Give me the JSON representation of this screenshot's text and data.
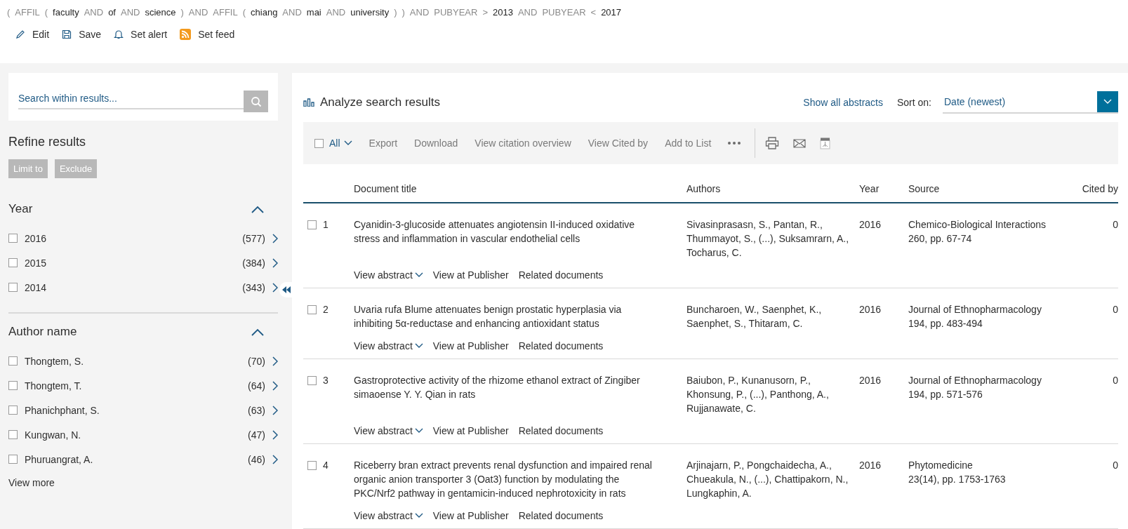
{
  "query": [
    {
      "text": "(",
      "kind": "operator"
    },
    {
      "text": "AFFIL",
      "kind": "operator"
    },
    {
      "text": "(",
      "kind": "operator"
    },
    {
      "text": "faculty",
      "kind": "term"
    },
    {
      "text": "AND",
      "kind": "operator"
    },
    {
      "text": "of",
      "kind": "term"
    },
    {
      "text": "AND",
      "kind": "operator"
    },
    {
      "text": "science",
      "kind": "term"
    },
    {
      "text": ")",
      "kind": "operator"
    },
    {
      "text": "AND",
      "kind": "operator"
    },
    {
      "text": "AFFIL",
      "kind": "operator"
    },
    {
      "text": "(",
      "kind": "operator"
    },
    {
      "text": "chiang",
      "kind": "term"
    },
    {
      "text": "AND",
      "kind": "operator"
    },
    {
      "text": "mai",
      "kind": "term"
    },
    {
      "text": "AND",
      "kind": "operator"
    },
    {
      "text": "university",
      "kind": "term"
    },
    {
      "text": ")",
      "kind": "operator"
    },
    {
      "text": ")",
      "kind": "operator"
    },
    {
      "text": "AND",
      "kind": "operator"
    },
    {
      "text": "PUBYEAR",
      "kind": "operator"
    },
    {
      "text": ">",
      "kind": "operator"
    },
    {
      "text": "2013",
      "kind": "term"
    },
    {
      "text": "AND",
      "kind": "operator"
    },
    {
      "text": "PUBYEAR",
      "kind": "operator"
    },
    {
      "text": "<",
      "kind": "operator"
    },
    {
      "text": "2017",
      "kind": "term"
    }
  ],
  "query_actions": [
    {
      "label": "Edit",
      "kind": "edit"
    },
    {
      "label": "Save",
      "kind": "save"
    },
    {
      "label": "Set alert",
      "kind": "alert"
    },
    {
      "label": "Set feed",
      "kind": "feed"
    }
  ],
  "sidebar": {
    "search": {
      "placeholder": "Search within results..."
    },
    "title": "Refine results",
    "buttons": [
      "Limit to",
      "Exclude"
    ],
    "facets": [
      {
        "title": "Year",
        "expanded": true,
        "items": [
          {
            "label": "2016",
            "count": "(577)",
            "checked": false
          },
          {
            "label": "2015",
            "count": "(384)",
            "checked": false
          },
          {
            "label": "2014",
            "count": "(343)",
            "checked": false
          }
        ]
      },
      {
        "title": "Author name",
        "expanded": true,
        "items": [
          {
            "label": "Thongtem, S.",
            "count": "(70)",
            "checked": false
          },
          {
            "label": "Thongtem, T.",
            "count": "(64)",
            "checked": false
          },
          {
            "label": "Phanichphant, S.",
            "count": "(63)",
            "checked": false
          },
          {
            "label": "Kungwan, N.",
            "count": "(47)",
            "checked": false
          },
          {
            "label": "Phuruangrat, A.",
            "count": "(46)",
            "checked": false
          }
        ],
        "more": "View more"
      }
    ]
  },
  "results": {
    "title": "Analyze search results",
    "show_all": "Show all abstracts",
    "sort_label": "Sort on:",
    "sort_value": "Date (newest)",
    "toolbar": {
      "select_all": {
        "label": "All",
        "checked": false
      },
      "actions": [
        "Export",
        "Download",
        "View citation overview",
        "View Cited by",
        "Add to List"
      ]
    },
    "columns": [
      "Document title",
      "Authors",
      "Year",
      "Source",
      "Cited by"
    ],
    "rows": [
      {
        "number": "1",
        "checked": false,
        "title": "Cyanidin-3-glucoside attenuates angiotensin II-induced oxidative stress and inflammation in vascular endothelial cells",
        "authors": "Sivasinprasasn, S., Pantan, R., Thummayot, S., (...), Suksamrarn, A., Tocharus, C.",
        "year": "2016",
        "source": "Chemico-Biological Interactions",
        "source_detail": "260, pp. 67-74",
        "cited_by": "0",
        "links": [
          "View abstract",
          "View at Publisher",
          "Related documents"
        ]
      },
      {
        "number": "2",
        "checked": false,
        "title": "Uvaria rufa Blume attenuates benign prostatic hyperplasia via inhibiting 5α-reductase and enhancing antioxidant status",
        "authors": "Buncharoen, W., Saenphet, K., Saenphet, S., Thitaram, C.",
        "year": "2016",
        "source": "Journal of Ethnopharmacology",
        "source_detail": "194, pp. 483-494",
        "cited_by": "0",
        "links": [
          "View abstract",
          "View at Publisher",
          "Related documents"
        ]
      },
      {
        "number": "3",
        "checked": false,
        "title": "Gastroprotective activity of the rhizome ethanol extract of Zingiber simaoense Y. Y. Qian in rats",
        "authors": "Baiubon, P., Kunanusorn, P., Khonsung, P., (...), Panthong, A., Rujjanawate, C.",
        "year": "2016",
        "source": "Journal of Ethnopharmacology",
        "source_detail": "194, pp. 571-576",
        "cited_by": "0",
        "links": [
          "View abstract",
          "View at Publisher",
          "Related documents"
        ]
      },
      {
        "number": "4",
        "checked": false,
        "title": "Riceberry bran extract prevents renal dysfunction and impaired renal organic anion transporter 3 (Oat3) function by modulating the PKC/Nrf2 pathway in gentamicin-induced nephrotoxicity in rats",
        "authors": "Arjinajarn, P., Pongchaidecha, A., Chueakula, N., (...), Chattipakorn, N., Lungkaphin, A.",
        "year": "2016",
        "source": "Phytomedicine",
        "source_detail": "23(14), pp. 1753-1763",
        "cited_by": "0",
        "links": [
          "View abstract",
          "View at Publisher",
          "Related documents"
        ]
      }
    ]
  }
}
